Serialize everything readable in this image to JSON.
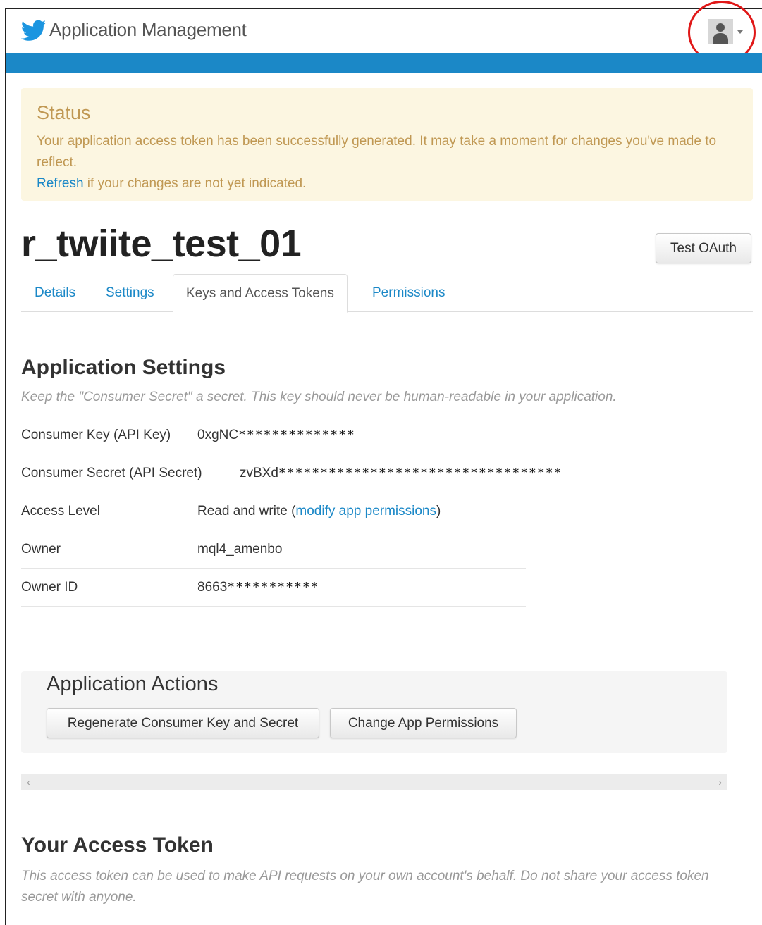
{
  "header": {
    "app_title": "Application Management",
    "brand_color": "#1b88c7",
    "logo_icon": "twitter-bird-icon"
  },
  "status": {
    "title": "Status",
    "message": "Your application access token has been successfully generated. It may take a moment for changes you've made to reflect.",
    "refresh_link": "Refresh",
    "refresh_suffix": " if your changes are not yet indicated."
  },
  "app": {
    "name": "r_twiite_test_01",
    "test_oauth_label": "Test OAuth"
  },
  "tabs": [
    {
      "label": "Details",
      "active": false
    },
    {
      "label": "Settings",
      "active": false
    },
    {
      "label": "Keys and Access Tokens",
      "active": true
    },
    {
      "label": "Permissions",
      "active": false
    }
  ],
  "settings": {
    "heading": "Application Settings",
    "note": "Keep the \"Consumer Secret\" a secret. This key should never be human-readable in your application.",
    "rows": [
      {
        "label": "Consumer Key (API Key)",
        "value_prefix": "0xgNC",
        "mask": "**************"
      },
      {
        "label": "Consumer Secret (API Secret)",
        "value_prefix": "zvBXd",
        "mask": "**********************************"
      },
      {
        "label": "Access Level",
        "value": "Read and write (",
        "link": "modify app permissions",
        "value_suffix": ")"
      },
      {
        "label": "Owner",
        "value": "mql4_amenbo"
      },
      {
        "label": "Owner ID",
        "value_prefix": "8663",
        "mask": "***********"
      }
    ]
  },
  "actions": {
    "heading": "Application Actions",
    "regenerate_label": "Regenerate Consumer Key and Secret",
    "change_permissions_label": "Change App Permissions"
  },
  "access_token": {
    "heading": "Your Access Token",
    "note": "This access token can be used to make API requests on your own account's behalf. Do not share your access token secret with anyone."
  }
}
